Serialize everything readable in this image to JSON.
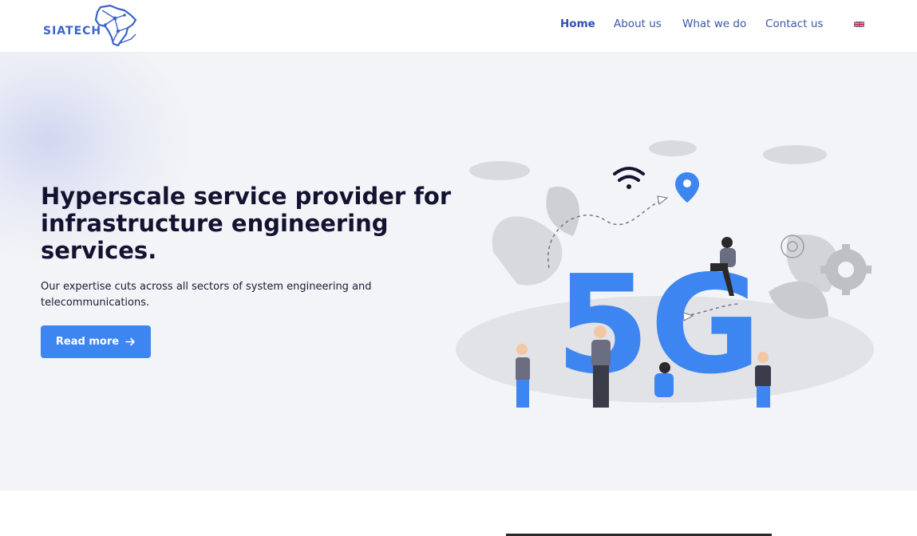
{
  "header": {
    "logo_text": "SIATECH",
    "nav": [
      {
        "label": "Home",
        "active": true
      },
      {
        "label": "About us",
        "active": false
      },
      {
        "label": "What we do",
        "active": false
      },
      {
        "label": "Contact us",
        "active": false
      }
    ],
    "language_icon": "uk-flag-icon"
  },
  "hero": {
    "title": "Hyperscale service provider for infrastructure engineering services.",
    "description": "Our expertise cuts across all sectors of system engineering and telecommunications.",
    "button_label": "Read more",
    "button_icon": "arrow-right-icon",
    "illustration_text": "5G"
  },
  "colors": {
    "accent": "#3d86f2",
    "nav_text": "#3a57a8",
    "title": "#121330",
    "hero_bg": "#f3f4f7"
  }
}
